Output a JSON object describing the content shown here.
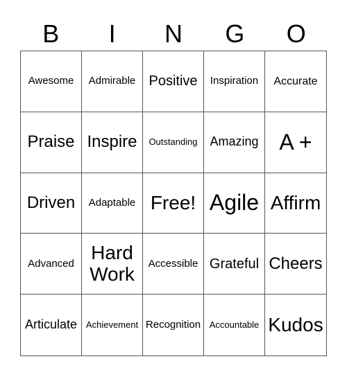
{
  "header": [
    "B",
    "I",
    "N",
    "G",
    "O"
  ],
  "cells": [
    "Awesome",
    "Admirable",
    "Positive",
    "Inspiration",
    "Accurate",
    "Praise",
    "Inspire",
    "Outstanding",
    "Amazing",
    "A +",
    "Driven",
    "Adaptable",
    "Free!",
    "Agile",
    "Affirm",
    "Advanced",
    "Hard Work",
    "Accessible",
    "Grateful",
    "Cheers",
    "Articulate",
    "Achievement",
    "Recognition",
    "Accountable",
    "Kudos"
  ]
}
